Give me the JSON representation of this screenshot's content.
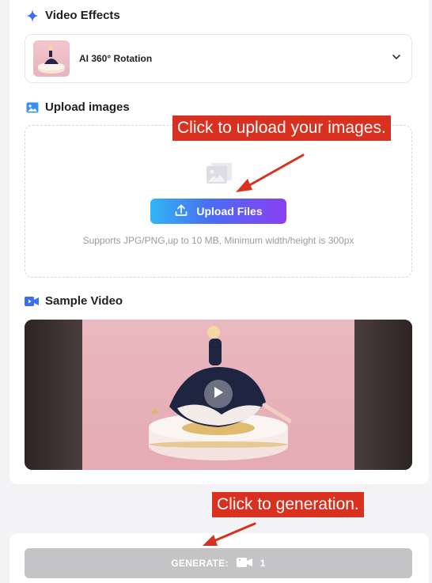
{
  "video_effects": {
    "title": "Video Effects",
    "selected_effect": "AI 360° Rotation",
    "icon": "sparkle-icon"
  },
  "upload": {
    "title": "Upload images",
    "button_label": "Upload Files",
    "support_text": "Supports JPG/PNG,up to 10 MB, Minimum width/height is 300px"
  },
  "sample": {
    "title": "Sample Video"
  },
  "generate": {
    "label": "GENERATE:",
    "credits": "1"
  },
  "annotations": {
    "upload_callout": "Click to upload your images.",
    "generate_callout": "Click to generation."
  },
  "colors": {
    "accent_blue": "#3b6ef5",
    "callout_red": "#d9311f",
    "generate_disabled": "#c4c4c6"
  }
}
